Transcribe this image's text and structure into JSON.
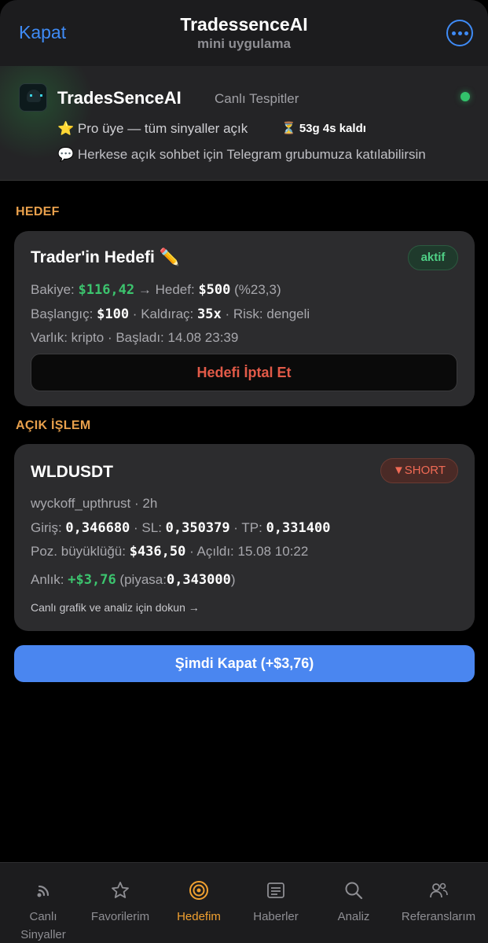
{
  "topbar": {
    "close_label": "Kapat",
    "title": "TradessenceAI",
    "subtitle": "mini uygulama"
  },
  "banner": {
    "brand": "TradesSenceAI",
    "tag": "Canlı Tespitler",
    "pro_text": "⭐ Pro üye — tüm sinyaller açık",
    "timer_text": "⏳ 53g 4s kaldı",
    "telegram_text": "💬 Herkese açık sohbet için Telegram grubumuza katılabilirsin",
    "status_color": "#33c26b"
  },
  "goal_section": {
    "label": "HEDEF",
    "title": "Trader'in Hedefi ✏️",
    "status": "aktif",
    "balance_label": "Bakiye:",
    "balance_value": "$116,42",
    "arrow": "→",
    "target_label": "Hedef:",
    "target_value": "$500",
    "target_pct": "(%23,3)",
    "start_label": "Başlangıç:",
    "start_value": "$100",
    "leverage_label": "Kaldıraç:",
    "leverage_value": "35x",
    "risk_label": "Risk:",
    "risk_value": "dengeli",
    "asset_label": "Varlık:",
    "asset_value": "kripto",
    "started_label": "Başladı:",
    "started_value": "14.08 23:39",
    "cancel_label": "Hedefi İptal Et"
  },
  "trade_section": {
    "label": "AÇIK İŞLEM",
    "symbol": "WLDUSDT",
    "side": "▼SHORT",
    "strategy": "wyckoff_upthrust",
    "timeframe": "2h",
    "entry_label": "Giriş:",
    "entry_value": "0,346680",
    "sl_label": "SL:",
    "sl_value": "0,350379",
    "tp_label": "TP:",
    "tp_value": "0,331400",
    "size_label": "Poz. büyüklüğü:",
    "size_value": "$436,50",
    "opened_label": "Açıldı:",
    "opened_value": "15.08 10:22",
    "now_label": "Anlık:",
    "now_value": "+$3,76",
    "market_label": "(piyasa:",
    "market_value": "0,343000",
    "market_close": ")",
    "hint": "Canlı grafik ve analiz için dokun →"
  },
  "close_button": "Şimdi Kapat (+$3,76)",
  "nav": {
    "items": [
      {
        "label": "Canlı Sinyaller",
        "icon": "wifi-signal-icon"
      },
      {
        "label": "Favorilerim",
        "icon": "star-icon"
      },
      {
        "label": "Hedefim",
        "icon": "target-icon"
      },
      {
        "label": "Haberler",
        "icon": "news-icon"
      },
      {
        "label": "Analiz",
        "icon": "search-icon"
      },
      {
        "label": "Referanslarım",
        "icon": "users-icon"
      }
    ],
    "active": "Hedefim",
    "active_color": "#f0a030"
  }
}
